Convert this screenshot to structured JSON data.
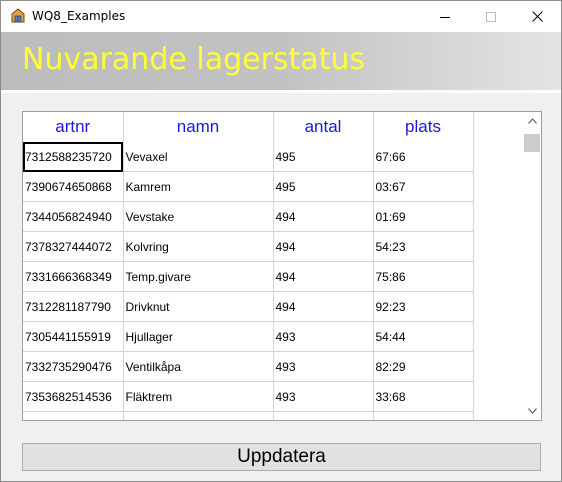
{
  "window": {
    "title": "WQ8_Examples"
  },
  "banner": {
    "title": "Nuvarande lagerstatus",
    "color": "#ffff33"
  },
  "table": {
    "header_color": "#1a1adc",
    "columns": [
      "artnr",
      "namn",
      "antal",
      "plats"
    ],
    "rows": [
      [
        "7312588235720",
        "Vevaxel",
        "495",
        "67:66"
      ],
      [
        "7390674650868",
        "Kamrem",
        "495",
        "03:67"
      ],
      [
        "7344056824940",
        "Vevstake",
        "494",
        "01:69"
      ],
      [
        "7378327444072",
        "Kolvring",
        "494",
        "54:23"
      ],
      [
        "7331666368349",
        "Temp.givare",
        "494",
        "75:86"
      ],
      [
        "7312281187790",
        "Drivknut",
        "494",
        "92:23"
      ],
      [
        "7305441155919",
        "Hjullager",
        "493",
        "54:44"
      ],
      [
        "7332735290476",
        "Ventilkåpa",
        "493",
        "82:29"
      ],
      [
        "7353682514536",
        "Fläktrem",
        "493",
        "33:68"
      ],
      [
        "",
        "",
        "",
        ""
      ]
    ],
    "selected_cell": "7312588235720"
  },
  "actions": {
    "update_label": "Uppdatera"
  }
}
